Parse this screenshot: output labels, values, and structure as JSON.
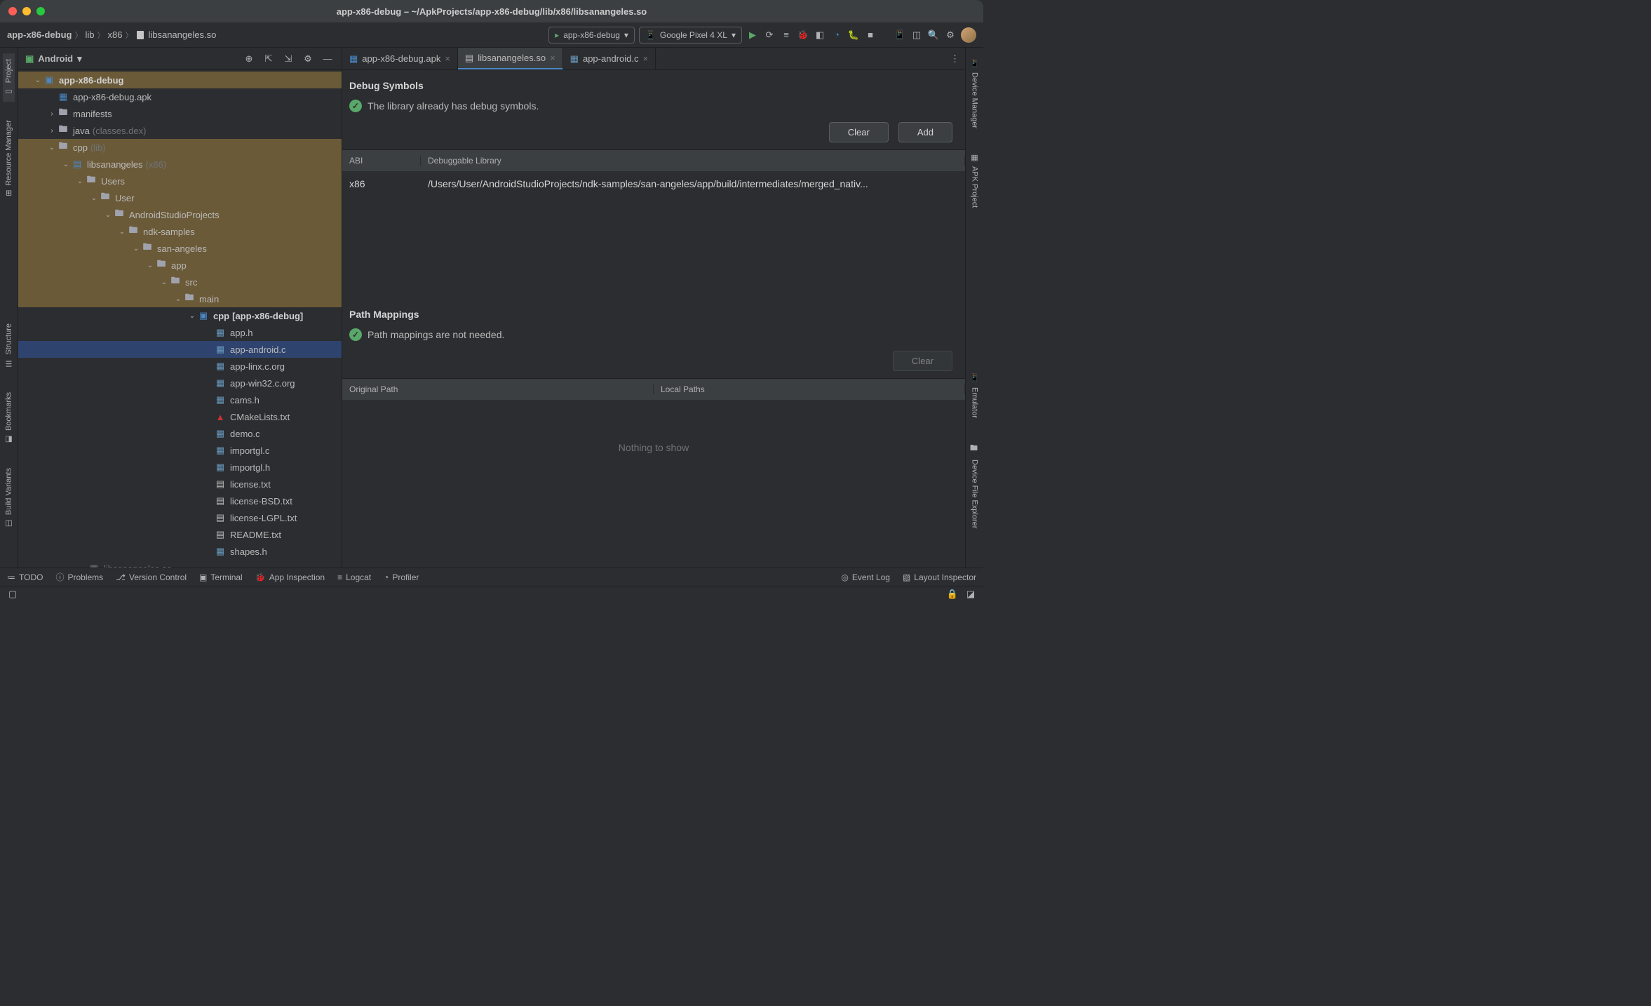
{
  "title": "app-x86-debug – ~/ApkProjects/app-x86-debug/lib/x86/libsanangeles.so",
  "breadcrumbs": {
    "project": "app-x86-debug",
    "dir1": "lib",
    "dir2": "x86",
    "file": "libsanangeles.so"
  },
  "toolbar": {
    "config": "app-x86-debug",
    "device": "Google Pixel 4 XL"
  },
  "projectHeader": {
    "title": "Android"
  },
  "tree": {
    "root": "app-x86-debug",
    "apk": "app-x86-debug.apk",
    "manifests": "manifests",
    "java": "java",
    "javaMeta": "(classes.dex)",
    "cpp": "cpp",
    "cppMeta": "(lib)",
    "libsan": "libsanangeles",
    "libsanMeta": "(x86)",
    "users": "Users",
    "user": "User",
    "asp": "AndroidStudioProjects",
    "ndk": "ndk-samples",
    "sanang": "san-angeles",
    "app": "app",
    "src": "src",
    "main": "main",
    "cpp2": "cpp",
    "cpp2Meta": "[app-x86-debug]",
    "apph": "app.h",
    "appandroid": "app-android.c",
    "applinx": "app-linx.c.org",
    "appwin": "app-win32.c.org",
    "cams": "cams.h",
    "cmake": "CMakeLists.txt",
    "demo": "demo.c",
    "importglc": "importgl.c",
    "importglh": "importgl.h",
    "license": "license.txt",
    "licensebsd": "license-BSD.txt",
    "licenselgpl": "license-LGPL.txt",
    "readme": "README.txt",
    "shapes": "shapes.h",
    "libsanso": "libsanangeles.so"
  },
  "tabs": {
    "t1": "app-x86-debug.apk",
    "t2": "libsanangeles.so",
    "t3": "app-android.c"
  },
  "editor": {
    "debugSymbolsTitle": "Debug Symbols",
    "debugSymbolsMsg": "The library already has debug symbols.",
    "clear": "Clear",
    "add": "Add",
    "abiHeader": "ABI",
    "libHeader": "Debuggable Library",
    "abi": "x86",
    "libPath": "/Users/User/AndroidStudioProjects/ndk-samples/san-angeles/app/build/intermediates/merged_nativ...",
    "pathMappingsTitle": "Path Mappings",
    "pathMappingsMsg": "Path mappings are not needed.",
    "origHeader": "Original Path",
    "localHeader": "Local Paths",
    "nothing": "Nothing to show"
  },
  "sidebarLeft": {
    "project": "Project",
    "resmgr": "Resource Manager",
    "structure": "Structure",
    "bookmarks": "Bookmarks",
    "buildvar": "Build Variants"
  },
  "sidebarRight": {
    "devmgr": "Device Manager",
    "apkproj": "APK Project",
    "emulator": "Emulator",
    "devfile": "Device File Explorer"
  },
  "bottom": {
    "todo": "TODO",
    "problems": "Problems",
    "vcs": "Version Control",
    "terminal": "Terminal",
    "appinsp": "App Inspection",
    "logcat": "Logcat",
    "profiler": "Profiler",
    "eventlog": "Event Log",
    "layoutinsp": "Layout Inspector"
  }
}
